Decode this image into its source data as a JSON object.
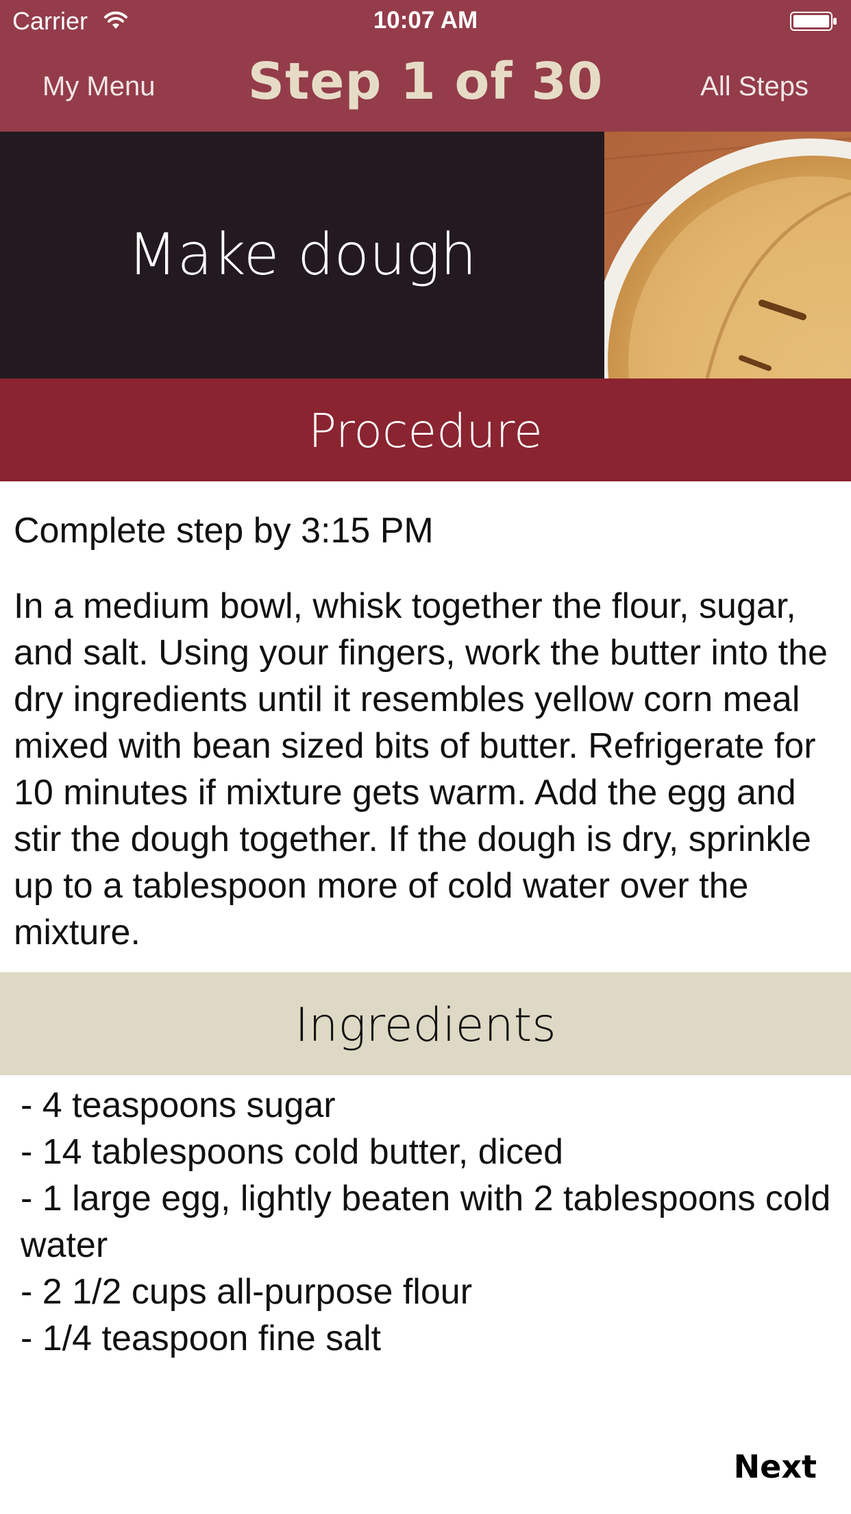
{
  "status_bar": {
    "carrier": "Carrier",
    "time": "10:07 AM",
    "wifi_icon": "wifi-icon",
    "battery_icon": "battery-icon"
  },
  "nav": {
    "left_label": "My Menu",
    "title": "Step 1 of 30",
    "right_label": "All Steps"
  },
  "hero": {
    "title": "Make dough",
    "image": "pie-photo"
  },
  "procedure": {
    "header": "Procedure",
    "deadline": "Complete step by 3:15 PM",
    "text": "In a medium bowl, whisk together the flour, sugar, and salt. Using your fingers, work the butter into the dry ingredients until it resembles yellow corn meal mixed with bean sized bits of butter. Refrigerate for 10 minutes if mixture gets warm. Add the egg and stir the dough together. If the dough is dry, sprinkle up to a tablespoon more of cold water over the mixture."
  },
  "ingredients": {
    "header": "Ingredients",
    "items": [
      "- 4 teaspoons sugar",
      "- 14 tablespoons cold butter, diced",
      "- 1 large egg, lightly beaten with 2 tablespoons cold water",
      "- 2 1/2 cups all-purpose flour",
      "- 1/4 teaspoon fine salt"
    ]
  },
  "footer": {
    "next_label": "Next"
  },
  "colors": {
    "nav_bar": "#943c4a",
    "hero_bg": "#231a21",
    "procedure_header": "#8a2431",
    "ingredients_header": "#ddd9c4",
    "nav_title": "#e6dcc6"
  }
}
